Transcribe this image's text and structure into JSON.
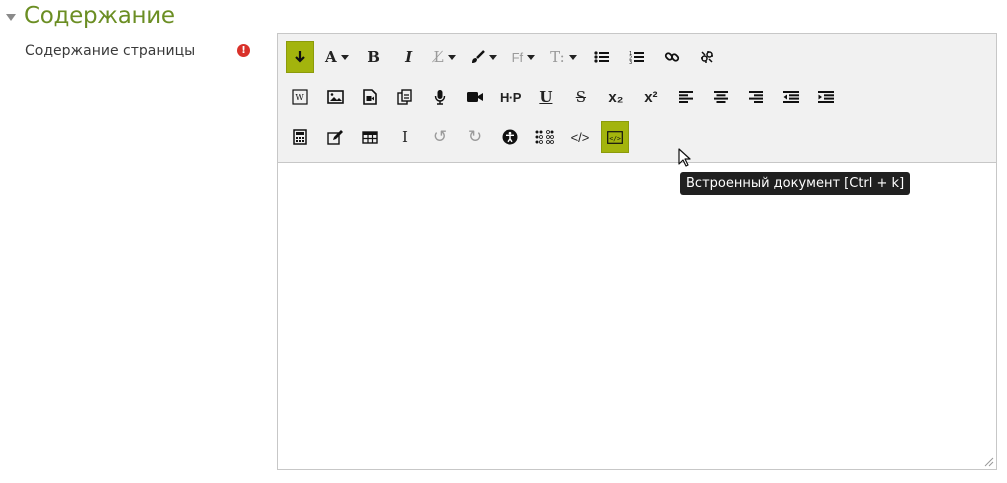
{
  "section": {
    "title": "Содержание"
  },
  "field": {
    "label": "Содержание страницы",
    "required_icon": "exclamation-icon",
    "required_mark": "!"
  },
  "colors": {
    "accent": "#a3b40d",
    "section_title": "#6b8e23",
    "required": "#d9312a",
    "tooltip_bg": "#202020"
  },
  "toolbar": {
    "row1": [
      {
        "icon": "collapse-toggle-icon",
        "glyph": "↧"
      },
      {
        "icon": "font-size-icon",
        "glyph": "A"
      },
      {
        "icon": "bold-icon",
        "glyph": "B"
      },
      {
        "icon": "italic-icon",
        "glyph": "I"
      },
      {
        "icon": "styles-icon",
        "glyph": "⁋"
      },
      {
        "icon": "font-color-icon",
        "glyph": "🖌"
      },
      {
        "icon": "font-family-icon",
        "glyph": "Ff"
      },
      {
        "icon": "font-size-t-icon",
        "glyph": "T:"
      },
      {
        "icon": "bullet-list-icon",
        "glyph": "☰"
      },
      {
        "icon": "numbered-list-icon",
        "glyph": "≣"
      },
      {
        "icon": "link-icon",
        "glyph": "🔗"
      },
      {
        "icon": "unlink-icon",
        "glyph": "⛓"
      }
    ],
    "row2": [
      {
        "icon": "word-import-icon",
        "glyph": "W"
      },
      {
        "icon": "image-icon",
        "glyph": "▣"
      },
      {
        "icon": "media-icon",
        "glyph": "▶"
      },
      {
        "icon": "paste-icon",
        "glyph": "⧉"
      },
      {
        "icon": "microphone-icon",
        "glyph": "🎙"
      },
      {
        "icon": "video-camera-icon",
        "glyph": "■"
      },
      {
        "icon": "h5p-icon",
        "glyph": "H·P"
      },
      {
        "icon": "underline-icon",
        "glyph": "U"
      },
      {
        "icon": "strikethrough-icon",
        "glyph": "S"
      },
      {
        "icon": "subscript-icon",
        "glyph": "x₂"
      },
      {
        "icon": "superscript-icon",
        "glyph": "x²"
      },
      {
        "icon": "align-left-icon",
        "glyph": "≡"
      },
      {
        "icon": "align-center-icon",
        "glyph": "≡"
      },
      {
        "icon": "align-right-icon",
        "glyph": "≡"
      },
      {
        "icon": "outdent-icon",
        "glyph": "⇤"
      },
      {
        "icon": "indent-icon",
        "glyph": "⇥"
      }
    ],
    "row3": [
      {
        "icon": "calculator-icon",
        "glyph": "▦"
      },
      {
        "icon": "edit-icon",
        "glyph": "✎"
      },
      {
        "icon": "table-icon",
        "glyph": "⊞"
      },
      {
        "icon": "text-cursor-icon",
        "glyph": "I"
      },
      {
        "icon": "undo-icon",
        "glyph": "↺"
      },
      {
        "icon": "redo-icon",
        "glyph": "↻"
      },
      {
        "icon": "accessibility-icon",
        "glyph": "♿"
      },
      {
        "icon": "braille-icon",
        "glyph": "⠿"
      },
      {
        "icon": "html-code-icon",
        "glyph": "</>"
      },
      {
        "icon": "embed-document-icon",
        "glyph": "</>"
      }
    ]
  },
  "tooltip": {
    "text": "Встроенный документ [Ctrl + k]"
  }
}
